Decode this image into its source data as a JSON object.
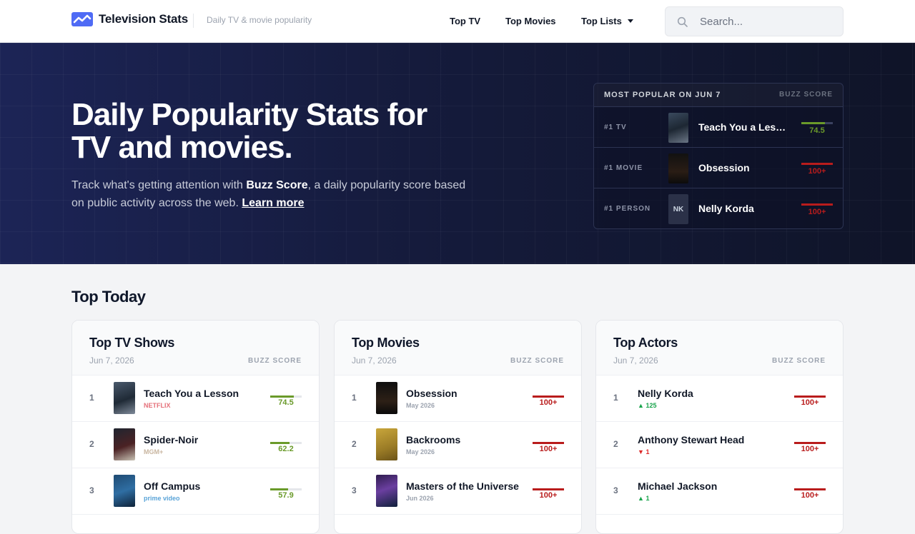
{
  "header": {
    "brand": "Television Stats",
    "tagline": "Daily TV & movie popularity",
    "nav": [
      "Top TV",
      "Top Movies",
      "Top Lists"
    ],
    "search_placeholder": "Search..."
  },
  "hero": {
    "title": "Daily Popularity Stats for TV and movies.",
    "sub_pre": "Track what's getting attention with ",
    "sub_bold": "Buzz Score",
    "sub_post": ", a daily popularity score based on public activity across the web.",
    "learn_more": "Learn more"
  },
  "popular": {
    "title": "MOST POPULAR ON JUN 7",
    "score_label": "BUZZ SCORE",
    "rows": [
      {
        "rank": "#1 TV",
        "name": "Teach You a Lesson",
        "value": "74.5",
        "fill": 0.745,
        "color": "green"
      },
      {
        "rank": "#1 MOVIE",
        "name": "Obsession",
        "value": "100+",
        "fill": 1.0,
        "color": "red"
      },
      {
        "rank": "#1 PERSON",
        "name": "Nelly Korda",
        "initials": "NK",
        "value": "100+",
        "fill": 1.0,
        "color": "red"
      }
    ]
  },
  "top_today": {
    "title": "Top Today",
    "score_label": "BUZZ SCORE",
    "tv": {
      "title": "Top TV Shows",
      "date": "Jun 7, 2026",
      "rows": [
        {
          "rank": "1",
          "name": "Teach You a Lesson",
          "sub": "NETFLIX",
          "sub_color": "#e5707a",
          "value": "74.5",
          "fill": 0.745,
          "color": "green"
        },
        {
          "rank": "2",
          "name": "Spider-Noir",
          "sub": "MGM+",
          "sub_color": "#c9b6a0",
          "value": "62.2",
          "fill": 0.622,
          "color": "green"
        },
        {
          "rank": "3",
          "name": "Off Campus",
          "sub": "prime video",
          "sub_color": "#5aa4d8",
          "value": "57.9",
          "fill": 0.579,
          "color": "green"
        }
      ]
    },
    "movies": {
      "title": "Top Movies",
      "date": "Jun 7, 2026",
      "rows": [
        {
          "rank": "1",
          "name": "Obsession",
          "sub": "May 2026",
          "value": "100+",
          "fill": 1.0,
          "color": "red"
        },
        {
          "rank": "2",
          "name": "Backrooms",
          "sub": "May 2026",
          "value": "100+",
          "fill": 1.0,
          "color": "red"
        },
        {
          "rank": "3",
          "name": "Masters of the Universe",
          "sub": "Jun 2026",
          "value": "100+",
          "fill": 1.0,
          "color": "red"
        }
      ]
    },
    "actors": {
      "title": "Top Actors",
      "date": "Jun 7, 2026",
      "rows": [
        {
          "rank": "1",
          "name": "Nelly Korda",
          "change": "125",
          "dir": "up",
          "value": "100+",
          "fill": 1.0,
          "color": "red"
        },
        {
          "rank": "2",
          "name": "Anthony Stewart Head",
          "change": "1",
          "dir": "down",
          "value": "100+",
          "fill": 1.0,
          "color": "red"
        },
        {
          "rank": "3",
          "name": "Michael Jackson",
          "change": "1",
          "dir": "up",
          "value": "100+",
          "fill": 1.0,
          "color": "red"
        }
      ]
    }
  },
  "colors": {
    "accent": "#4f6bf5",
    "green": "#6a9a2a",
    "red": "#b91c1c",
    "hero_bg": "#151b3c"
  }
}
